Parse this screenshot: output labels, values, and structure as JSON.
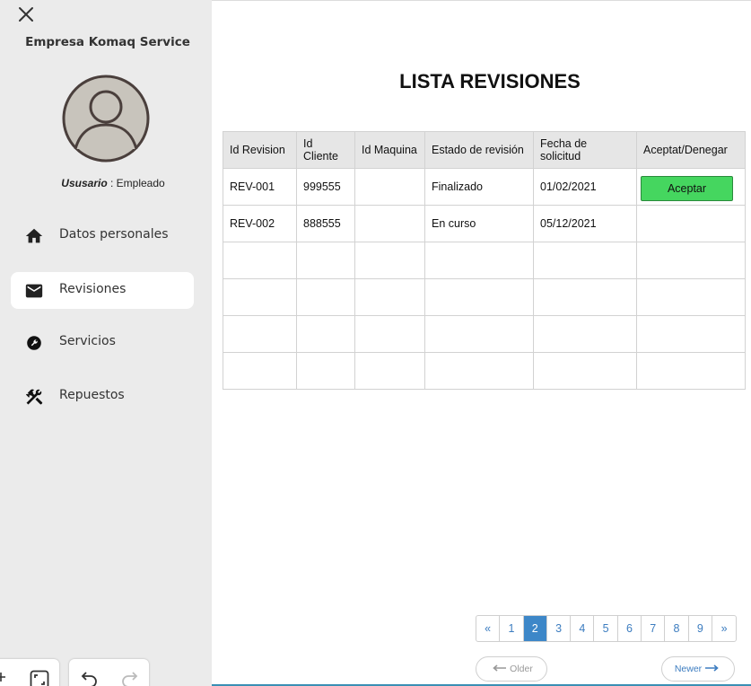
{
  "sidebar": {
    "company": "Empresa Komaq Service",
    "user_label": "Ususario",
    "user_role": " : Empleado",
    "items": [
      {
        "label": "Datos personales",
        "icon": "home-icon"
      },
      {
        "label": "Revisiones",
        "icon": "mail-icon",
        "active": true
      },
      {
        "label": "Servicios",
        "icon": "wrench-icon"
      },
      {
        "label": "Repuestos",
        "icon": "tools-icon"
      }
    ]
  },
  "main": {
    "title": "LISTA REVISIONES",
    "table": {
      "headers": [
        "Id Revision",
        "Id Cliente",
        "Id Maquina",
        "Estado de revisión",
        "Fecha de solicitud",
        "Aceptat/Denegar"
      ],
      "rows": [
        {
          "id_revision": "REV-001",
          "id_cliente": "999555",
          "id_maquina": "",
          "estado": "Finalizado",
          "fecha": "01/02/2021",
          "action": "Aceptar"
        },
        {
          "id_revision": "REV-002",
          "id_cliente": "888555",
          "id_maquina": "",
          "estado": "En curso",
          "fecha": "05/12/2021",
          "action": ""
        },
        {
          "id_revision": "",
          "id_cliente": "",
          "id_maquina": "",
          "estado": "",
          "fecha": "",
          "action": ""
        },
        {
          "id_revision": "",
          "id_cliente": "",
          "id_maquina": "",
          "estado": "",
          "fecha": "",
          "action": ""
        },
        {
          "id_revision": "",
          "id_cliente": "",
          "id_maquina": "",
          "estado": "",
          "fecha": "",
          "action": ""
        },
        {
          "id_revision": "",
          "id_cliente": "",
          "id_maquina": "",
          "estado": "",
          "fecha": "",
          "action": ""
        }
      ]
    },
    "pagination": {
      "first": "«",
      "pages": [
        "1",
        "2",
        "3",
        "4",
        "5",
        "6",
        "7",
        "8",
        "9"
      ],
      "current": "2",
      "last": "»",
      "older": "Older",
      "newer": "Newer"
    }
  },
  "colors": {
    "sidebar_bg": "#ebebeb",
    "accept_button": "#45d65f",
    "pager_active": "#3d87c8",
    "link_blue": "#3d7dc0"
  }
}
